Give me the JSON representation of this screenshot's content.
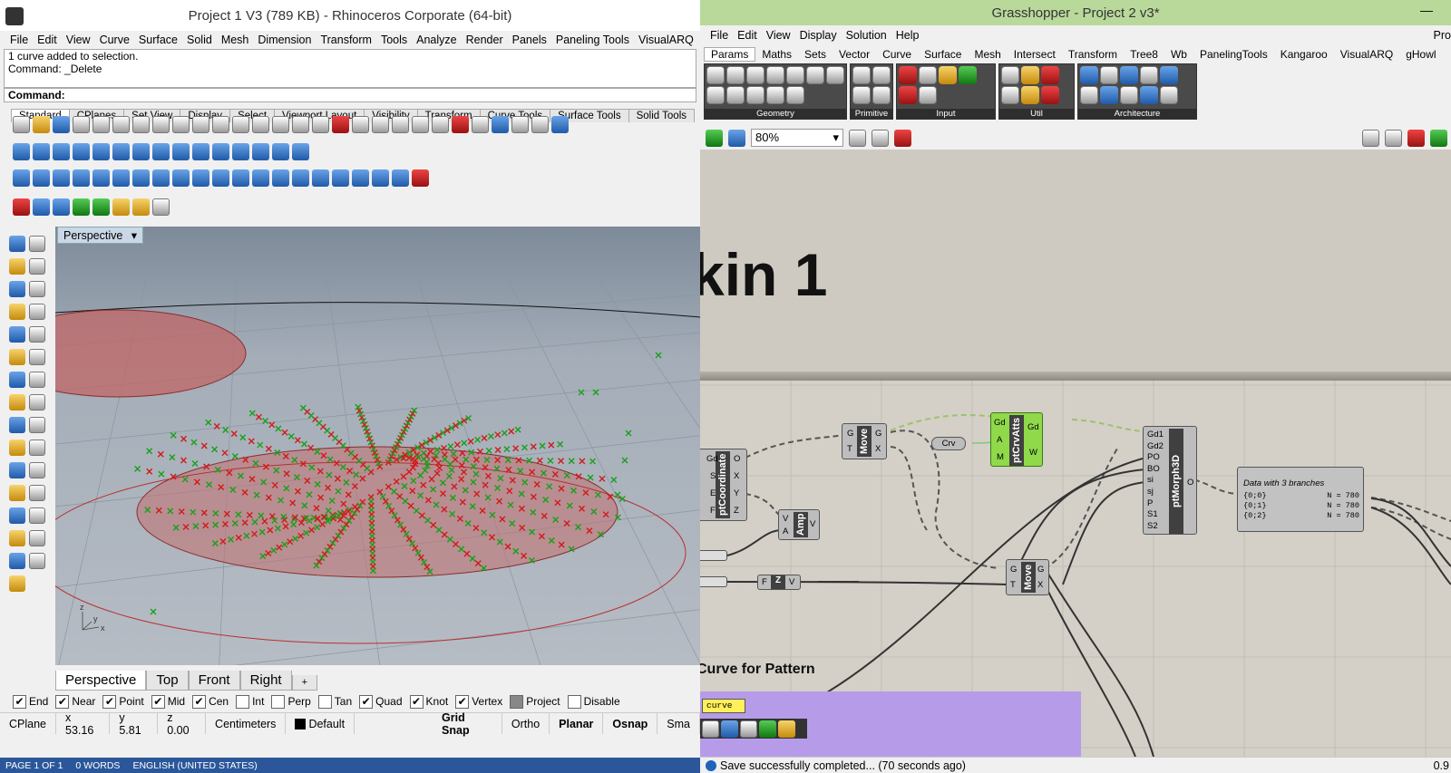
{
  "rhino": {
    "title": "Project 1 V3 (789 KB) - Rhinoceros Corporate (64-bit)",
    "menu": [
      "File",
      "Edit",
      "View",
      "Curve",
      "Surface",
      "Solid",
      "Mesh",
      "Dimension",
      "Transform",
      "Tools",
      "Analyze",
      "Render",
      "Panels",
      "Paneling Tools",
      "VisualARQ"
    ],
    "command_history": [
      "1 curve added to selection.",
      "Command: _Delete"
    ],
    "command_prompt": "Command:",
    "toolbar_tabs": [
      "Standard",
      "CPlanes",
      "Set View",
      "Display",
      "Select",
      "Viewport Layout",
      "Visibility",
      "Transform",
      "Curve Tools",
      "Surface Tools",
      "Solid Tools"
    ],
    "active_toolbar_tab": "Standard",
    "viewport_label": "Perspective",
    "view_tabs": [
      "Perspective",
      "Top",
      "Front",
      "Right"
    ],
    "add_view_tab": "+",
    "osnaps": [
      {
        "label": "End",
        "checked": true
      },
      {
        "label": "Near",
        "checked": true
      },
      {
        "label": "Point",
        "checked": true
      },
      {
        "label": "Mid",
        "checked": true
      },
      {
        "label": "Cen",
        "checked": true
      },
      {
        "label": "Int",
        "checked": false
      },
      {
        "label": "Perp",
        "checked": false
      },
      {
        "label": "Tan",
        "checked": false
      },
      {
        "label": "Quad",
        "checked": true
      },
      {
        "label": "Knot",
        "checked": true
      },
      {
        "label": "Vertex",
        "checked": true
      },
      {
        "label": "Project",
        "checked": false
      },
      {
        "label": "Disable",
        "checked": false
      }
    ],
    "status": {
      "cplane": "CPlane",
      "x": "x 53.16",
      "y": "y 5.81",
      "z": "z 0.00",
      "units": "Centimeters",
      "layer": "Default",
      "grid_snap": "Grid Snap",
      "ortho": "Ortho",
      "planar": "Planar",
      "osnap": "Osnap",
      "smart": "Sma"
    },
    "axis": {
      "x": "x",
      "y": "y",
      "z": "z"
    }
  },
  "word_status": {
    "page": "PAGE 1 OF 1",
    "words": "0 WORDS",
    "language": "ENGLISH (UNITED STATES)"
  },
  "grasshopper": {
    "title": "Grasshopper - Project 2 v3*",
    "menu": [
      "File",
      "Edit",
      "View",
      "Display",
      "Solution",
      "Help"
    ],
    "menu_right": "Pro",
    "tabs": [
      "Params",
      "Maths",
      "Sets",
      "Vector",
      "Curve",
      "Surface",
      "Mesh",
      "Intersect",
      "Transform",
      "Tree8",
      "Wb",
      "PanelingTools",
      "Kangaroo",
      "VisualARQ",
      "gHowl"
    ],
    "active_tab": "Params",
    "ribbon_groups": [
      "Geometry",
      "Primitive",
      "Input",
      "Util",
      "Architecture"
    ],
    "zoom": "80%",
    "group_title": "kin 1",
    "components": {
      "pt_coordinate": {
        "name": "ptCoordinate",
        "inputs": [
          "Gd",
          "S",
          "E",
          "F"
        ],
        "outputs": [
          "O",
          "X",
          "Y",
          "Z"
        ]
      },
      "move1": {
        "name": "Move",
        "inputs": [
          "G",
          "T"
        ],
        "outputs": [
          "G",
          "X"
        ]
      },
      "crv": {
        "name": "Crv"
      },
      "pt_crv_atts": {
        "name": "ptCrvAtts",
        "inputs": [
          "Gd",
          "A",
          "M"
        ],
        "outputs": [
          "Gd",
          "W"
        ]
      },
      "amp": {
        "name": "Amp",
        "inputs": [
          "V",
          "A"
        ],
        "outputs": [
          "V"
        ]
      },
      "unit_z": {
        "name": "Z",
        "inputs": [
          "F"
        ],
        "outputs": [
          "V"
        ]
      },
      "move2": {
        "name": "Move",
        "inputs": [
          "G",
          "T"
        ],
        "outputs": [
          "G",
          "X"
        ]
      },
      "pt_morph_3d": {
        "name": "ptMorph3D",
        "inputs": [
          "Gd1",
          "Gd2",
          "PO",
          "BO",
          "si",
          "sj",
          "P",
          "S1",
          "S2"
        ],
        "outputs": [
          "O"
        ]
      }
    },
    "data_panel": {
      "title": "Data with 3 branches",
      "rows": [
        {
          "path": "{0;0}",
          "count": "N = 780"
        },
        {
          "path": "{0;1}",
          "count": "N = 780"
        },
        {
          "path": "{0;2}",
          "count": "N = 780"
        }
      ]
    },
    "scribble": "Curve for Pattern",
    "curve_panel": "curve",
    "status": "Save successfully completed... (70 seconds ago)",
    "status_right": "0.9"
  }
}
